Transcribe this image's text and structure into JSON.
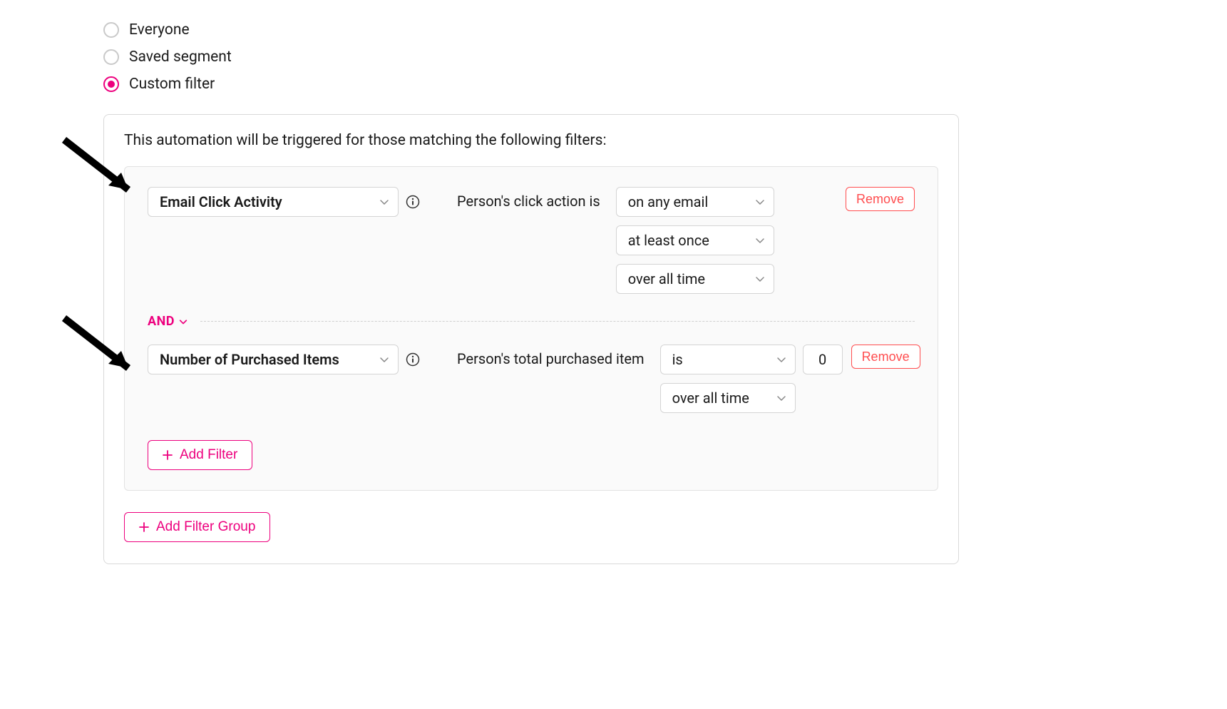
{
  "radios": {
    "everyone": "Everyone",
    "saved_segment": "Saved segment",
    "custom_filter": "Custom filter",
    "selected": "custom_filter"
  },
  "panel": {
    "intro": "This automation will be triggered for those matching the following filters:"
  },
  "filter1": {
    "type_label": "Email Click Activity",
    "sentence": "Person's click action is",
    "opt_scope": "on any email",
    "opt_freq": "at least once",
    "opt_time": "over all time",
    "remove": "Remove"
  },
  "join": {
    "label": "AND"
  },
  "filter2": {
    "type_label": "Number of Purchased Items",
    "sentence": "Person's total purchased item",
    "op": "is",
    "value": "0",
    "opt_time": "over all time",
    "remove": "Remove"
  },
  "buttons": {
    "add_filter": "Add Filter",
    "add_filter_group": "Add Filter Group"
  }
}
